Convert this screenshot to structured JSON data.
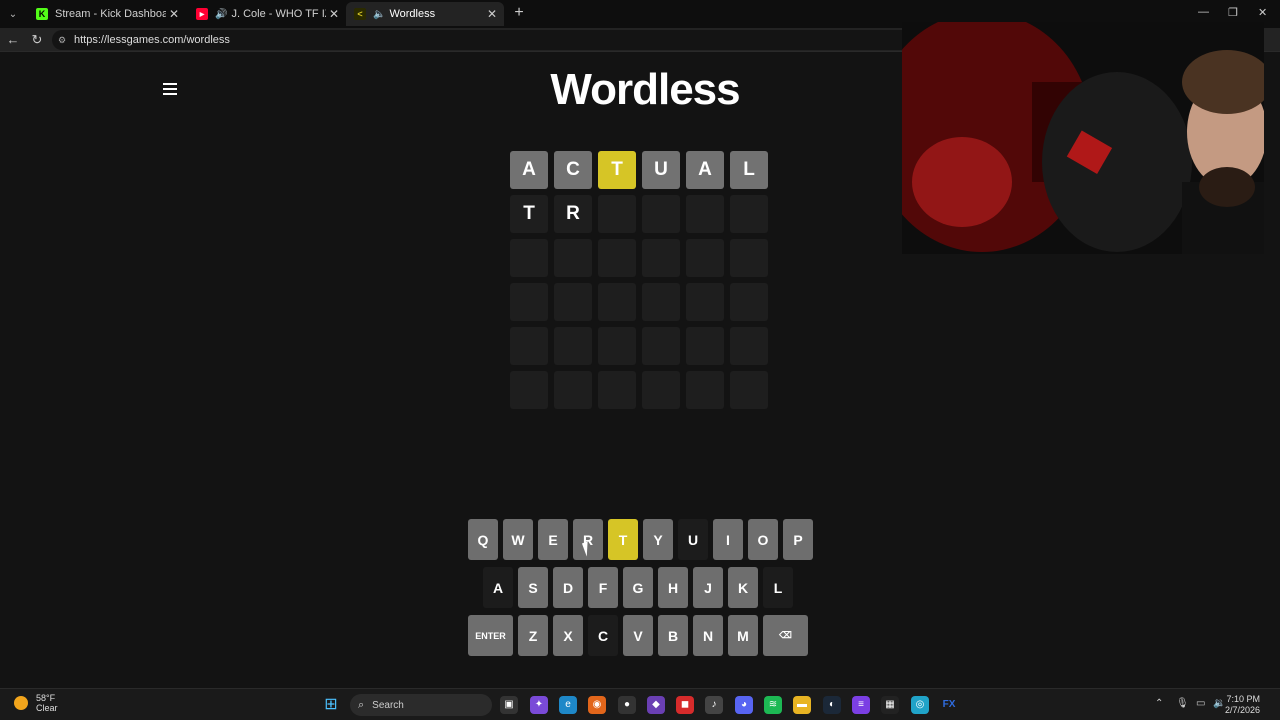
{
  "browser": {
    "tabs": [
      {
        "title": "Stream - Kick Dashboard",
        "favicon": "K",
        "active": false
      },
      {
        "title": "J. Cole - WHO TF IZ U (Officia",
        "favicon": "▶",
        "active": false
      },
      {
        "title": "Wordless",
        "favicon": "<",
        "active": true
      }
    ],
    "url": "https://lessgames.com/wordless"
  },
  "game": {
    "title": "Wordless",
    "rows": [
      [
        {
          "l": "A",
          "s": "absent"
        },
        {
          "l": "C",
          "s": "absent"
        },
        {
          "l": "T",
          "s": "present"
        },
        {
          "l": "U",
          "s": "absent"
        },
        {
          "l": "A",
          "s": "absent"
        },
        {
          "l": "L",
          "s": "absent"
        }
      ],
      [
        {
          "l": "T",
          "s": "typed"
        },
        {
          "l": "R",
          "s": "typed"
        },
        {
          "l": "",
          "s": "empty"
        },
        {
          "l": "",
          "s": "empty"
        },
        {
          "l": "",
          "s": "empty"
        },
        {
          "l": "",
          "s": "empty"
        }
      ],
      [
        {
          "l": "",
          "s": "empty"
        },
        {
          "l": "",
          "s": "empty"
        },
        {
          "l": "",
          "s": "empty"
        },
        {
          "l": "",
          "s": "empty"
        },
        {
          "l": "",
          "s": "empty"
        },
        {
          "l": "",
          "s": "empty"
        }
      ],
      [
        {
          "l": "",
          "s": "empty"
        },
        {
          "l": "",
          "s": "empty"
        },
        {
          "l": "",
          "s": "empty"
        },
        {
          "l": "",
          "s": "empty"
        },
        {
          "l": "",
          "s": "empty"
        },
        {
          "l": "",
          "s": "empty"
        }
      ],
      [
        {
          "l": "",
          "s": "empty"
        },
        {
          "l": "",
          "s": "empty"
        },
        {
          "l": "",
          "s": "empty"
        },
        {
          "l": "",
          "s": "empty"
        },
        {
          "l": "",
          "s": "empty"
        },
        {
          "l": "",
          "s": "empty"
        }
      ],
      [
        {
          "l": "",
          "s": "empty"
        },
        {
          "l": "",
          "s": "empty"
        },
        {
          "l": "",
          "s": "empty"
        },
        {
          "l": "",
          "s": "empty"
        },
        {
          "l": "",
          "s": "empty"
        },
        {
          "l": "",
          "s": "empty"
        }
      ]
    ],
    "keyboard": [
      [
        {
          "k": "Q"
        },
        {
          "k": "W"
        },
        {
          "k": "E"
        },
        {
          "k": "R"
        },
        {
          "k": "T",
          "s": "present"
        },
        {
          "k": "Y"
        },
        {
          "k": "U",
          "s": "dark"
        },
        {
          "k": "I"
        },
        {
          "k": "O"
        },
        {
          "k": "P"
        }
      ],
      [
        {
          "k": "A",
          "s": "dark"
        },
        {
          "k": "S"
        },
        {
          "k": "D"
        },
        {
          "k": "F"
        },
        {
          "k": "G"
        },
        {
          "k": "H"
        },
        {
          "k": "J"
        },
        {
          "k": "K"
        },
        {
          "k": "L",
          "s": "dark"
        }
      ],
      [
        {
          "k": "ENTER",
          "wide": true
        },
        {
          "k": "Z"
        },
        {
          "k": "X"
        },
        {
          "k": "C",
          "s": "dark"
        },
        {
          "k": "V"
        },
        {
          "k": "B"
        },
        {
          "k": "N"
        },
        {
          "k": "M"
        },
        {
          "k": "⌫",
          "wide": true,
          "name": "backspace"
        }
      ]
    ]
  },
  "taskbar": {
    "weather_temp": "58°F",
    "weather_desc": "Clear",
    "search_placeholder": "Search",
    "time": "7:10 PM",
    "date": "2/7/2026"
  },
  "colors": {
    "present": "#d6c526",
    "absent": "#727272",
    "empty": "#1e1e1e"
  }
}
